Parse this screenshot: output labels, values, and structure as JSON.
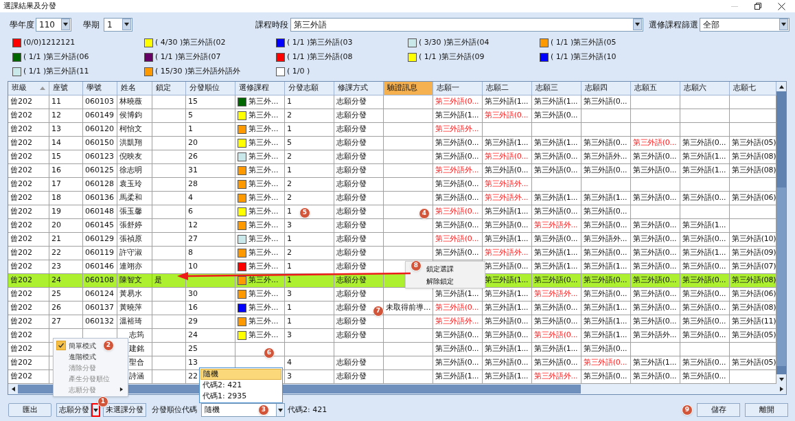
{
  "window": {
    "title": "選課結果及分發"
  },
  "filters": [
    {
      "label": "學年度",
      "value": "110"
    },
    {
      "label": "學期",
      "value": "1"
    },
    {
      "label": "課程時段",
      "value": "第三外語"
    },
    {
      "label": "選修課程篩選",
      "value": "全部"
    }
  ],
  "legend": [
    {
      "text": "(0/0)1212121",
      "color": "#ff0000"
    },
    {
      "text": "( 4/30 )第三外語(02",
      "color": "#ffff00"
    },
    {
      "text": "( 1/1 )第三外語(03",
      "color": "#0000ff"
    },
    {
      "text": "( 3/30 )第三外語(04",
      "color": "#c8e8ea"
    },
    {
      "text": "( 1/1 )第三外語(05",
      "color": "#ff9900"
    },
    {
      "text": "( 1/1 )第三外語(06",
      "color": "#006600"
    },
    {
      "text": "( 1/1 )第三外語(07",
      "color": "#660066"
    },
    {
      "text": "( 1/1 )第三外語(08",
      "color": "#ff0000"
    },
    {
      "text": "( 1/1 )第三外語(09",
      "color": "#ffff00"
    },
    {
      "text": "( 1/1 )第三外語(10",
      "color": "#0000ff"
    },
    {
      "text": "( 1/1 )第三外語(11",
      "color": "#c8e8ea"
    },
    {
      "text": "( 15/30 )第三外語外語外",
      "color": "#ff9900"
    },
    {
      "text": "( 1/0 )",
      "color": "#ffffff"
    }
  ],
  "table": {
    "columns": [
      {
        "label": "班級",
        "sorted": true,
        "selected": false
      },
      {
        "label": "座號",
        "sorted": false,
        "selected": false
      },
      {
        "label": "學號",
        "sorted": false,
        "selected": false
      },
      {
        "label": "姓名",
        "sorted": false,
        "selected": false
      },
      {
        "label": "鎖定",
        "sorted": false,
        "selected": false
      },
      {
        "label": "分發順位",
        "sorted": false,
        "selected": false
      },
      {
        "label": "選修課程",
        "sorted": false,
        "selected": false
      },
      {
        "label": "分發志願",
        "sorted": false,
        "selected": false
      },
      {
        "label": "修課方式",
        "sorted": false,
        "selected": false
      },
      {
        "label": "驗證訊息",
        "sorted": false,
        "selected": true
      },
      {
        "label": "志願一",
        "sorted": false,
        "selected": false
      },
      {
        "label": "志願二",
        "sorted": false,
        "selected": false
      },
      {
        "label": "志願三",
        "sorted": false,
        "selected": false
      },
      {
        "label": "志願四",
        "sorted": false,
        "selected": false
      },
      {
        "label": "志願五",
        "sorted": false,
        "selected": false
      },
      {
        "label": "志願六",
        "sorted": false,
        "selected": false
      },
      {
        "label": "志願七",
        "sorted": false,
        "selected": false
      }
    ],
    "rows": [
      {
        "selected": false,
        "class": "曾202",
        "seat": "11",
        "id": "060103",
        "name": "林曉薇",
        "order": "15",
        "course": {
          "text": "第三外...",
          "color": "#006600"
        },
        "wish": "1",
        "method": "志願分發",
        "wishes": [
          {
            "text": "第三外語(0...",
            "assigned": true
          },
          {
            "text": "第三外語(1...",
            "assigned": false
          },
          {
            "text": "第三外語(1...",
            "assigned": false
          },
          {
            "text": "第三外語(0...",
            "assigned": false
          }
        ]
      },
      {
        "selected": false,
        "class": "曾202",
        "seat": "12",
        "id": "060149",
        "name": "侯博鈞",
        "order": "5",
        "course": {
          "text": "第三外...",
          "color": "#ffff00"
        },
        "wish": "2",
        "method": "志願分發",
        "wishes": [
          {
            "text": "第三外語(1...",
            "assigned": false
          },
          {
            "text": "第三外語(0...",
            "assigned": true
          },
          {
            "text": "第三外語(0...",
            "assigned": false
          }
        ]
      },
      {
        "selected": false,
        "class": "曾202",
        "seat": "13",
        "id": "060120",
        "name": "柯怡文",
        "order": "1",
        "course": {
          "text": "第三外...",
          "color": "#ff9900"
        },
        "wish": "1",
        "method": "志願分發",
        "wishes": [
          {
            "text": "第三外語外...",
            "assigned": true
          }
        ]
      },
      {
        "selected": false,
        "class": "曾202",
        "seat": "14",
        "id": "060150",
        "name": "洪凱翔",
        "order": "20",
        "course": {
          "text": "第三外...",
          "color": "#ffff00"
        },
        "wish": "5",
        "method": "志願分發",
        "wishes": [
          {
            "text": "第三外語(0...",
            "assigned": false
          },
          {
            "text": "第三外語(1...",
            "assigned": false
          },
          {
            "text": "第三外語(1...",
            "assigned": false
          },
          {
            "text": "第三外語(0...",
            "assigned": false
          },
          {
            "text": "第三外語(0...",
            "assigned": true
          },
          {
            "text": "第三外語(0...",
            "assigned": false
          },
          {
            "text": "第三外語(05)",
            "assigned": false
          }
        ]
      },
      {
        "selected": false,
        "class": "曾202",
        "seat": "15",
        "id": "060123",
        "name": "倪映友",
        "order": "26",
        "course": {
          "text": "第三外...",
          "color": "#c8e8ea"
        },
        "wish": "2",
        "method": "志願分發",
        "wishes": [
          {
            "text": "第三外語(0...",
            "assigned": false
          },
          {
            "text": "第三外語(0...",
            "assigned": true
          },
          {
            "text": "第三外語(0...",
            "assigned": false
          },
          {
            "text": "第三外語外...",
            "assigned": false
          },
          {
            "text": "第三外語(0...",
            "assigned": false
          },
          {
            "text": "第三外語(1...",
            "assigned": false
          },
          {
            "text": "第三外語(08)",
            "assigned": false
          }
        ]
      },
      {
        "selected": false,
        "class": "曾202",
        "seat": "16",
        "id": "060125",
        "name": "徐志明",
        "order": "31",
        "course": {
          "text": "第三外...",
          "color": "#ff9900"
        },
        "wish": "1",
        "method": "志願分發",
        "wishes": [
          {
            "text": "第三外語外...",
            "assigned": true
          },
          {
            "text": "第三外語(0...",
            "assigned": false
          },
          {
            "text": "第三外語(0...",
            "assigned": false
          },
          {
            "text": "第三外語(0...",
            "assigned": false
          },
          {
            "text": "第三外語(0...",
            "assigned": false
          },
          {
            "text": "第三外語(1...",
            "assigned": false
          },
          {
            "text": "第三外語(08)",
            "assigned": false
          }
        ]
      },
      {
        "selected": false,
        "class": "曾202",
        "seat": "17",
        "id": "060128",
        "name": "袁玉玲",
        "order": "28",
        "course": {
          "text": "第三外...",
          "color": "#ff9900"
        },
        "wish": "2",
        "method": "志願分發",
        "wishes": [
          {
            "text": "第三外語(0...",
            "assigned": false
          },
          {
            "text": "第三外語外...",
            "assigned": true
          }
        ]
      },
      {
        "selected": false,
        "class": "曾202",
        "seat": "18",
        "id": "060136",
        "name": "馬柔和",
        "order": "4",
        "course": {
          "text": "第三外...",
          "color": "#ff9900"
        },
        "wish": "2",
        "method": "志願分發",
        "wishes": [
          {
            "text": "第三外語(0...",
            "assigned": false
          },
          {
            "text": "第三外語外...",
            "assigned": true
          },
          {
            "text": "第三外語(1...",
            "assigned": false
          },
          {
            "text": "第三外語(1...",
            "assigned": false
          },
          {
            "text": "第三外語(0...",
            "assigned": false
          },
          {
            "text": "第三外語(0...",
            "assigned": false
          },
          {
            "text": "第三外語(06)",
            "assigned": false
          }
        ]
      },
      {
        "selected": false,
        "class": "曾202",
        "seat": "19",
        "id": "060148",
        "name": "張玉馨",
        "order": "6",
        "course": {
          "text": "第三外...",
          "color": "#ffff00"
        },
        "wish": "1",
        "method": "志願分發",
        "wishes": [
          {
            "text": "第三外語(0...",
            "assigned": true
          },
          {
            "text": "第三外語(1...",
            "assigned": false
          },
          {
            "text": "第三外語(0...",
            "assigned": false
          },
          {
            "text": "第三外語(0...",
            "assigned": false
          }
        ]
      },
      {
        "selected": false,
        "class": "曾202",
        "seat": "20",
        "id": "060145",
        "name": "張舒婷",
        "order": "12",
        "course": {
          "text": "第三外...",
          "color": "#ff9900"
        },
        "wish": "3",
        "method": "志願分發",
        "wishes": [
          {
            "text": "第三外語(0...",
            "assigned": false
          },
          {
            "text": "第三外語(0...",
            "assigned": false
          },
          {
            "text": "第三外語外...",
            "assigned": true
          },
          {
            "text": "第三外語(0...",
            "assigned": false
          },
          {
            "text": "第三外語(0...",
            "assigned": false
          },
          {
            "text": "第三外語(1...",
            "assigned": false
          }
        ]
      },
      {
        "selected": false,
        "class": "曾202",
        "seat": "21",
        "id": "060129",
        "name": "張禎原",
        "order": "27",
        "course": {
          "text": "第三外...",
          "color": "#c8e8ea"
        },
        "wish": "1",
        "method": "志願分發",
        "wishes": [
          {
            "text": "第三外語(0...",
            "assigned": true
          },
          {
            "text": "第三外語(1...",
            "assigned": false
          },
          {
            "text": "第三外語(0...",
            "assigned": false
          },
          {
            "text": "第三外語外...",
            "assigned": false
          },
          {
            "text": "第三外語(0...",
            "assigned": false
          },
          {
            "text": "第三外語(0...",
            "assigned": false
          },
          {
            "text": "第三外語(10)",
            "assigned": false
          }
        ]
      },
      {
        "selected": false,
        "class": "曾202",
        "seat": "22",
        "id": "060119",
        "name": "許守淑",
        "order": "8",
        "course": {
          "text": "第三外...",
          "color": "#ff9900"
        },
        "wish": "2",
        "method": "志願分發",
        "wishes": [
          {
            "text": "第三外語(0...",
            "assigned": false
          },
          {
            "text": "第三外語外...",
            "assigned": true
          },
          {
            "text": "第三外語(1...",
            "assigned": false
          },
          {
            "text": "第三外語(0...",
            "assigned": false
          },
          {
            "text": "第三外語(0...",
            "assigned": false
          },
          {
            "text": "第三外語(1...",
            "assigned": false
          },
          {
            "text": "第三外語(09)",
            "assigned": false
          }
        ]
      },
      {
        "selected": false,
        "class": "曾202",
        "seat": "23",
        "id": "060146",
        "name": "連翊亦",
        "order": "10",
        "course": {
          "text": "第三外...",
          "color": "#ff0000"
        },
        "wish": "1",
        "method": "志願分發",
        "wishes": [
          {
            "kind": "blank"
          },
          {
            "text": "第三外語(0...",
            "assigned": false
          },
          {
            "text": "第三外語(1...",
            "assigned": false
          },
          {
            "text": "第三外語(1...",
            "assigned": false
          },
          {
            "text": "第三外語(0...",
            "assigned": false
          },
          {
            "text": "第三外語(0...",
            "assigned": false
          },
          {
            "text": "第三外語(07)",
            "assigned": false
          }
        ]
      },
      {
        "selected": true,
        "class": "曾202",
        "seat": "24",
        "id": "060108",
        "name": "陳智文",
        "lock": "是",
        "course": {
          "text": "第三外...",
          "color": "#ff9900"
        },
        "wish": "1",
        "method": "志願分發",
        "wishes": [
          {
            "kind": "blank"
          },
          {
            "text": "第三外語(1...",
            "assigned": false
          },
          {
            "text": "第三外語(0...",
            "assigned": false
          },
          {
            "text": "第三外語(0...",
            "assigned": false
          },
          {
            "text": "第三外語(0...",
            "assigned": false
          },
          {
            "text": "第三外語(0...",
            "assigned": false
          },
          {
            "text": "第三外語(08)",
            "assigned": false
          }
        ]
      },
      {
        "selected": false,
        "class": "曾202",
        "seat": "25",
        "id": "060124",
        "name": "黃易水",
        "order": "30",
        "course": {
          "text": "第三外...",
          "color": "#ff9900"
        },
        "wish": "3",
        "method": "志願分發",
        "wishes": [
          {
            "text": "第三外語(1...",
            "assigned": false
          },
          {
            "text": "第三外語(1...",
            "assigned": false
          },
          {
            "text": "第三外語外...",
            "assigned": true
          },
          {
            "text": "第三外語(0...",
            "assigned": false
          },
          {
            "text": "第三外語(0...",
            "assigned": false
          },
          {
            "text": "第三外語(0...",
            "assigned": false
          },
          {
            "text": "第三外語(06)",
            "assigned": false
          }
        ]
      },
      {
        "selected": false,
        "class": "曾202",
        "seat": "26",
        "id": "060137",
        "name": "黃曉萍",
        "order": "16",
        "course": {
          "text": "第三外...",
          "color": "#0000ff"
        },
        "wish": "1",
        "method": "志願分發",
        "message": "未取得前導...",
        "wishes": [
          {
            "text": "第三外語(0...",
            "assigned": true
          },
          {
            "text": "第三外語(1...",
            "assigned": false
          },
          {
            "text": "第三外語(0...",
            "assigned": false
          },
          {
            "text": "第三外語(1...",
            "assigned": false
          },
          {
            "text": "第三外語(0...",
            "assigned": false
          },
          {
            "text": "第三外語(0...",
            "assigned": false
          },
          {
            "text": "第三外語(08)",
            "assigned": false
          }
        ]
      },
      {
        "selected": false,
        "class": "曾202",
        "seat": "27",
        "id": "060132",
        "name": "溫裕琦",
        "order": "29",
        "course": {
          "text": "第三外...",
          "color": "#ff9900"
        },
        "wish": "1",
        "method": "志願分發",
        "wishes": [
          {
            "text": "第三外語外...",
            "assigned": true
          },
          {
            "text": "第三外語(0...",
            "assigned": false
          },
          {
            "text": "第三外語(0...",
            "assigned": false
          },
          {
            "text": "第三外語(1...",
            "assigned": false
          },
          {
            "text": "第三外語(0...",
            "assigned": false
          },
          {
            "text": "第三外語(0...",
            "assigned": false
          },
          {
            "text": "第三外語(11)",
            "assigned": false
          }
        ]
      },
      {
        "selected": false,
        "class": "曾202",
        "name": "志筠",
        "order": "24",
        "course": {
          "text": "第三外...",
          "color": "#ffff00"
        },
        "wish": "3",
        "method": "志願分發",
        "wishes": [
          {
            "text": "第三外語(0...",
            "assigned": false
          },
          {
            "text": "第三外語(0...",
            "assigned": false
          },
          {
            "text": "第三外語(0...",
            "assigned": true
          },
          {
            "text": "第三外語(1...",
            "assigned": false
          },
          {
            "text": "第三外語外...",
            "assigned": false
          },
          {
            "text": "第三外語(0...",
            "assigned": false
          },
          {
            "text": "第三外語(05)",
            "assigned": false
          }
        ]
      },
      {
        "selected": false,
        "class": "曾202",
        "name": "建銘",
        "order": "25",
        "wishes": [
          {
            "text": "第三外語(0...",
            "assigned": false
          },
          {
            "text": "第三外語(1...",
            "assigned": false
          },
          {
            "text": "第三外語(1...",
            "assigned": false
          },
          {
            "text": "第三外語(0...",
            "assigned": false
          }
        ]
      },
      {
        "selected": false,
        "class": "曾202",
        "name": "聖合",
        "order": "13",
        "wish": "4",
        "method": "志願分發",
        "wishes": [
          {
            "text": "第三外語(0...",
            "assigned": false
          },
          {
            "text": "第三外語(0...",
            "assigned": false
          },
          {
            "text": "第三外語(0...",
            "assigned": false
          },
          {
            "text": "第三外語(0...",
            "assigned": true
          },
          {
            "text": "第三外語(1...",
            "assigned": false
          },
          {
            "text": "第三外語(0...",
            "assigned": false
          },
          {
            "text": "第三外語(05)",
            "assigned": false
          }
        ]
      },
      {
        "selected": false,
        "class": "曾202",
        "name": "詩涵",
        "order": "22",
        "wish": "3",
        "method": "志願分發",
        "wishes": [
          {
            "text": "第三外語(1...",
            "assigned": false
          },
          {
            "text": "第三外語(1...",
            "assigned": false
          },
          {
            "text": "第三外語外...",
            "assigned": true
          },
          {
            "text": "第三外語(0...",
            "assigned": false
          },
          {
            "text": "第三外語(0...",
            "assigned": false
          },
          {
            "text": "第三外語(0...",
            "assigned": false
          }
        ]
      }
    ]
  },
  "mode_menu": [
    {
      "label": "簡單模式",
      "checked": true,
      "disabled": false,
      "submenu": false
    },
    {
      "label": "進階模式",
      "checked": false,
      "disabled": false,
      "submenu": false
    },
    {
      "label": "清除分發",
      "checked": false,
      "disabled": true,
      "submenu": false
    },
    {
      "label": "產生分發順位",
      "checked": false,
      "disabled": true,
      "submenu": false
    },
    {
      "label": "志願分發",
      "checked": false,
      "disabled": true,
      "submenu": true
    }
  ],
  "order_code_options": [
    {
      "label": "隨機",
      "selected": true
    },
    {
      "label": "代碼2: 421",
      "selected": false
    },
    {
      "label": "代碼1: 2935",
      "selected": false
    }
  ],
  "row_menu": [
    "鎖定選課",
    "解除鎖定"
  ],
  "bottom_bar": {
    "export": "匯出",
    "assign": "志願分發",
    "unselected_assign": "未選課分發",
    "order_code_label": "分發順位代碼",
    "order_code_value": "隨機",
    "order_code_info": "代碼2: 421",
    "save": "儲存",
    "close": "離開"
  },
  "annotations": [
    "1",
    "2",
    "3",
    "4",
    "5",
    "6",
    "7",
    "8",
    "9"
  ]
}
